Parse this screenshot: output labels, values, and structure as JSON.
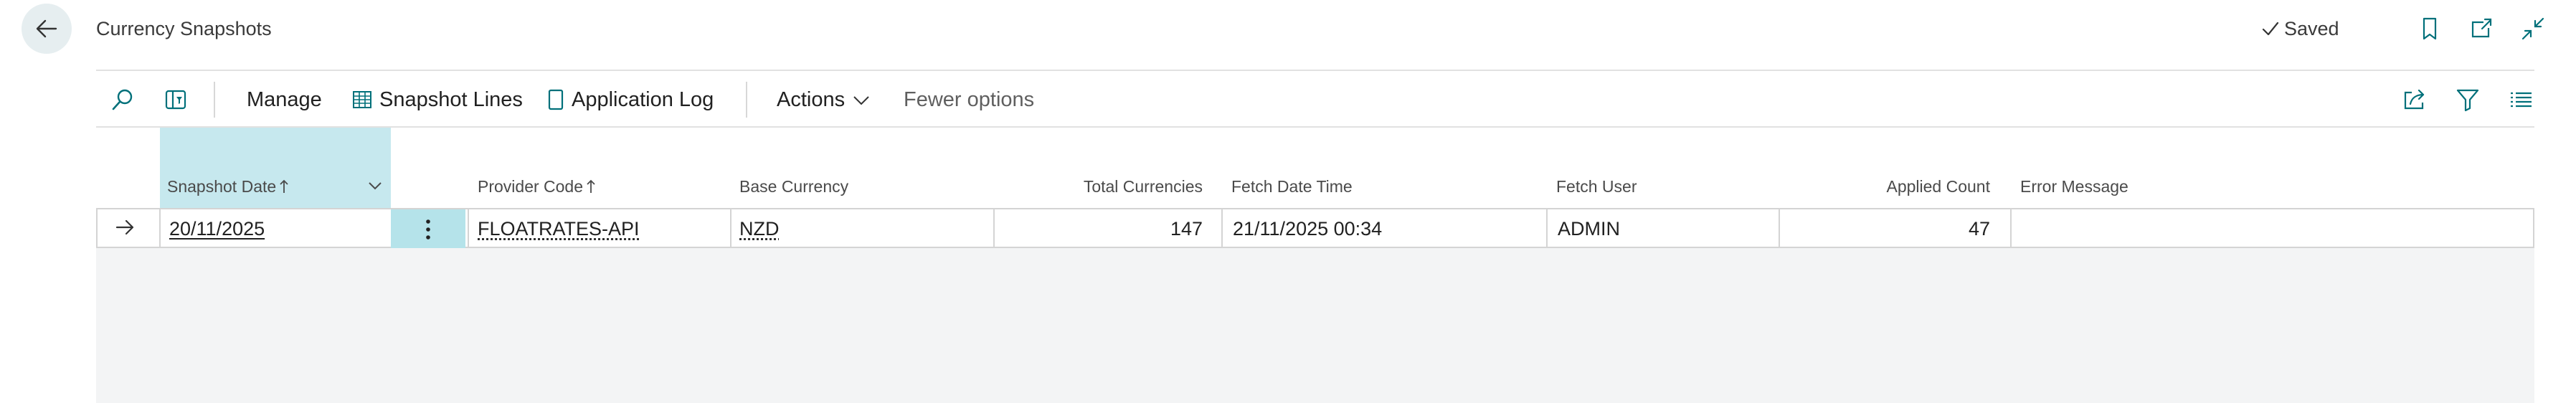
{
  "header": {
    "title": "Currency Snapshots",
    "saved_label": "Saved"
  },
  "actions": {
    "manage": "Manage",
    "snapshot_lines": "Snapshot Lines",
    "application_log": "Application Log",
    "actions_menu": "Actions",
    "fewer_options": "Fewer options"
  },
  "columns": {
    "snapshot_date": "Snapshot Date",
    "provider_code": "Provider Code",
    "base_currency": "Base Currency",
    "total_currencies": "Total Currencies",
    "fetch_date_time": "Fetch Date Time",
    "fetch_user": "Fetch User",
    "applied_count": "Applied Count",
    "error_message": "Error Message"
  },
  "rows": [
    {
      "snapshot_date": "20/11/2025",
      "provider_code": "FLOATRATES-API",
      "base_currency": "NZD",
      "total_currencies": "147",
      "fetch_date_time": "21/11/2025 00:34",
      "fetch_user": "ADMIN",
      "applied_count": "47",
      "error_message": ""
    }
  ],
  "icons": {
    "back": "arrow-left-icon",
    "saved": "checkmark-icon",
    "bookmark": "bookmark-icon",
    "open_new": "open-in-new-window-icon",
    "collapse": "collapse-icon",
    "search": "search-icon",
    "filter_pane": "filter-pane-icon",
    "snapshot_lines": "table-grid-icon",
    "application_log": "document-icon",
    "share": "share-icon",
    "filter": "filter-icon",
    "list": "list-view-icon",
    "row_selected": "arrow-right-icon",
    "row_menu": "vertical-ellipsis-icon"
  },
  "colors": {
    "accent": "#00707a",
    "selected_column": "#c6e8ee",
    "back_circle": "#e6eef0"
  }
}
